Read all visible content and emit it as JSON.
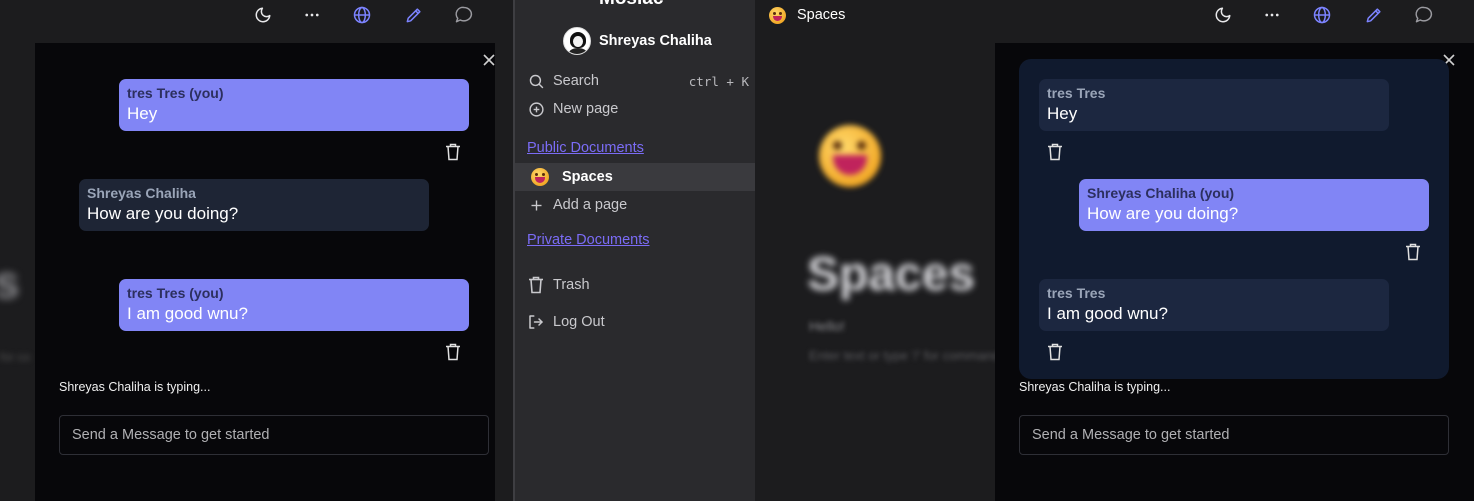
{
  "toolbar": {
    "icons": [
      "moon-icon",
      "more-icon",
      "globe-icon",
      "pencil-icon",
      "chat-icon"
    ]
  },
  "left_chat": {
    "messages": [
      {
        "sender": "tres Tres (you)",
        "text": "Hey",
        "mine": true
      },
      {
        "sender": "Shreyas Chaliha",
        "text": "How are you doing?",
        "mine": false
      },
      {
        "sender": "tres Tres (you)",
        "text": "I am good wnu?",
        "mine": true
      }
    ],
    "typing": "Shreyas Chaliha is typing...",
    "input_placeholder": "Send a Message to get started"
  },
  "right_chat": {
    "messages": [
      {
        "sender": "tres Tres",
        "text": "Hey",
        "mine": false
      },
      {
        "sender": "Shreyas Chaliha (you)",
        "text": "How are you doing?",
        "mine": true
      },
      {
        "sender": "tres Tres",
        "text": "I am good wnu?",
        "mine": false
      }
    ],
    "typing": "Shreyas Chaliha is typing...",
    "input_placeholder": "Send a Message to get started"
  },
  "sidebar": {
    "app_name": "Mosiac",
    "user_name": "Shreyas Chaliha",
    "search_label": "Search",
    "search_shortcut": "ctrl + K",
    "new_page_label": "New page",
    "public_section": "Public Documents",
    "pages": [
      {
        "label": "Spaces",
        "icon": "smiley-emoji"
      }
    ],
    "add_page_label": "Add a page",
    "private_section": "Private Documents",
    "trash_label": "Trash",
    "logout_label": "Log Out"
  },
  "document": {
    "breadcrumb": "Spaces",
    "title": "Spaces",
    "body_text": "Hello!",
    "placeholder": "Enter text or type '/' for commands"
  },
  "colors": {
    "accent": "#8185f5",
    "link": "#7b6cf6",
    "toolbar_blue": "#7c83ff",
    "panel_bg": "#07070a",
    "sidebar_bg": "#2a2a2d"
  }
}
